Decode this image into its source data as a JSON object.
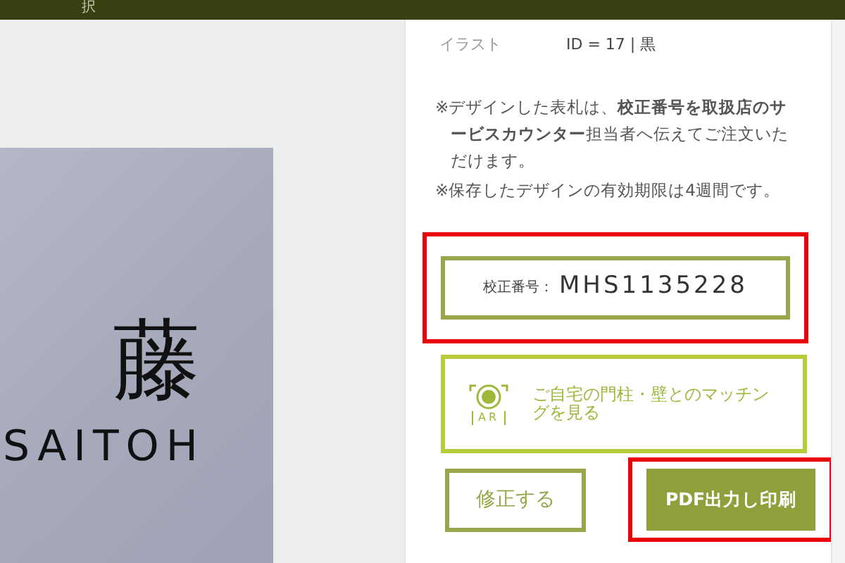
{
  "top_bar": {
    "label": "択"
  },
  "preview": {
    "name_kanji": "藤",
    "name_roman": "SAITOH"
  },
  "details": [
    {
      "label": "イラスト",
      "value": "ID = 17 | 黒"
    }
  ],
  "notes": [
    "※デザインした表札は、**校正番号を取扱店のサービスカウンター**担当者へ伝えてご注文いただけます。",
    "※保存したデザインの有効期限は4週間です。"
  ],
  "proof": {
    "label": "校正番号：",
    "value": "MHS1135228",
    "highlighted": true
  },
  "ar_button": {
    "label": "ご自宅の門柱・壁とのマッチングを見る",
    "icon_text": "AR"
  },
  "buttons": [
    {
      "label": "修正する",
      "kind": "outline",
      "highlighted": false
    },
    {
      "label": "PDF出力し印刷",
      "kind": "filled",
      "highlighted": true
    }
  ]
}
